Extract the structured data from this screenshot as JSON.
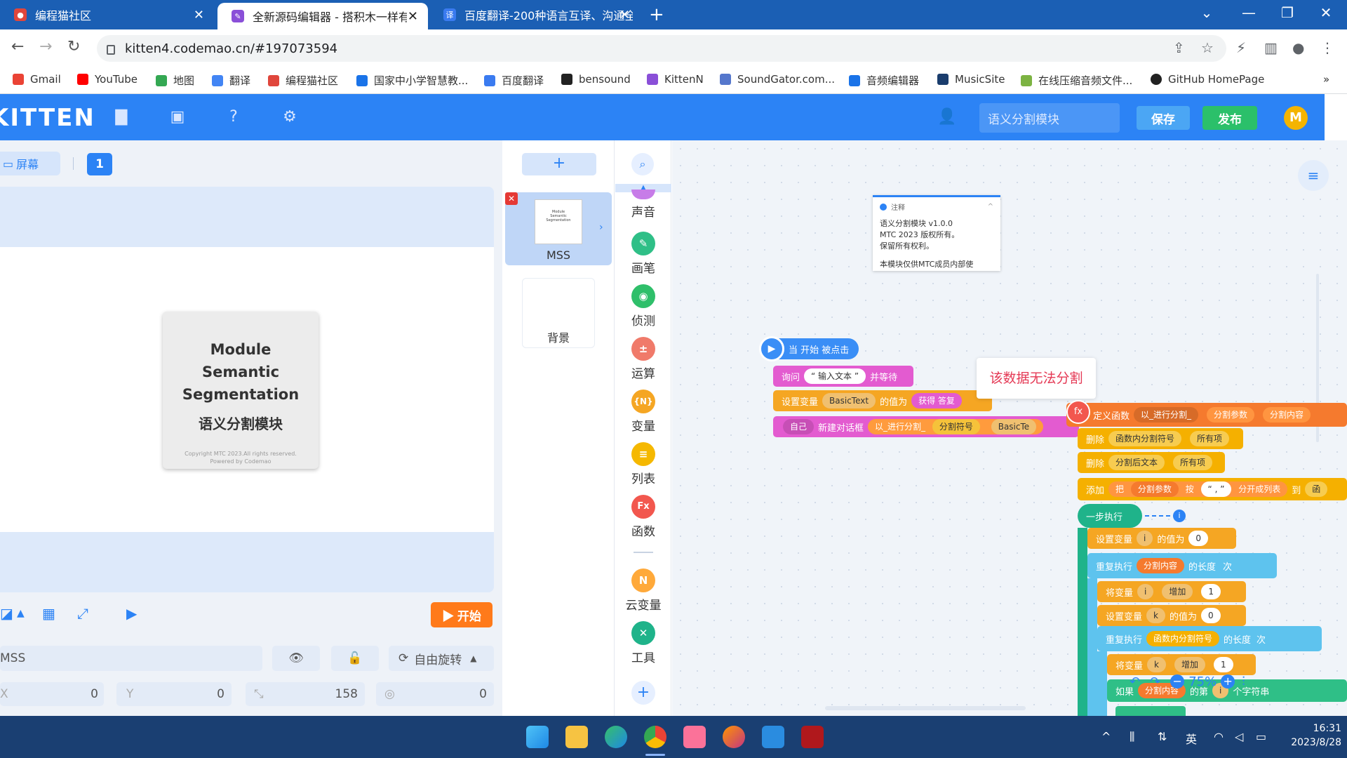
{
  "browser": {
    "tabs": [
      {
        "title": "编程猫社区",
        "active": false
      },
      {
        "title": "全新源码编辑器 - 搭积木一样有趣",
        "active": true
      },
      {
        "title": "百度翻译-200种语言互译、沟通全世界",
        "active": false
      }
    ],
    "url": "kitten4.codemao.cn/#197073594",
    "bookmarks": [
      "Gmail",
      "YouTube",
      "地图",
      "翻译",
      "编程猫社区",
      "国家中小学智慧教...",
      "百度翻译",
      "bensound",
      "KittenN",
      "SoundGator.com...",
      "音频编辑器",
      "MusicSite",
      "在线压缩音频文件...",
      "GitHub HomePage"
    ],
    "bookmarks_more": "»"
  },
  "editor": {
    "logo": "KITTEN",
    "project_name": "语义分割模块",
    "save_label": "保存",
    "publish_label": "发布",
    "avatar_letter": "M",
    "screen_label": "屏幕",
    "page_number": "1",
    "start_label": "开始",
    "cover": {
      "line1": "Module",
      "line2": "Semantic",
      "line3": "Segmentation",
      "subtitle": "语义分割模块",
      "copyright": "Copyright MTC 2023.All rights reserved.",
      "powered": "Powered by Codemao"
    },
    "sprite_field": "MSS",
    "rotation_label": "自由旋转",
    "x_label": "X",
    "x_value": "0",
    "y_label": "Y",
    "y_value": "0",
    "size_value": "158",
    "rotation_value": "0",
    "sprites": [
      {
        "name": "MSS"
      }
    ],
    "background_label": "背景",
    "add_label": "+",
    "categories": [
      {
        "name": "声音",
        "color": "#c77ce8",
        "glyph": "♪"
      },
      {
        "name": "画笔",
        "color": "#2fbf87",
        "glyph": "✎"
      },
      {
        "name": "侦测",
        "color": "#2fbf6a",
        "glyph": "◉"
      },
      {
        "name": "运算",
        "color": "#f07a6a",
        "glyph": "±"
      },
      {
        "name": "变量",
        "color": "#f5a623",
        "glyph": "{N}"
      },
      {
        "name": "列表",
        "color": "#f5b800",
        "glyph": "≡"
      },
      {
        "name": "函数",
        "color": "#f2574e",
        "glyph": "Fx"
      },
      {
        "name": "云变量",
        "color": "#ffa93a",
        "glyph": "N"
      },
      {
        "name": "工具",
        "color": "#1fb38a",
        "glyph": "✕"
      }
    ],
    "comment": {
      "title": "注释",
      "line1": "语义分割模块 v1.0.0",
      "line2": "MTC 2023 版权所有。",
      "line3": "保留所有权利。",
      "line4": "本模块仅供MTC成员内部使"
    },
    "tooltip": "该数据无法分割",
    "zoom": "75%",
    "blocks": {
      "when_start": "当 开始 被点击",
      "ask": "询问",
      "ask_text": "“ 输入文本 ”",
      "ask_wait": "并等待",
      "set_var": "设置变量",
      "var_basic": "BasicText",
      "value_of": "的值为",
      "get_answer": "获得 答复",
      "self": "自己",
      "new_dialog": "新建对话框",
      "split_fn": "以_进行分割_",
      "split_sep": "分割符号",
      "basic_te": "BasicTe",
      "define_fn": "定义函数",
      "fn_name": "以_进行分割_",
      "param1": "分割参数",
      "param2": "分割内容",
      "delete": "删除",
      "list1": "函数内分割符号",
      "all_items": "所有项",
      "list2": "分割后文本",
      "add": "添加",
      "take": "把",
      "by": "按",
      "comma": "“ , ”",
      "split_list": "分开成列表",
      "to": "到",
      "func_short": "函",
      "step_exec": "一步执行",
      "var_i": "i",
      "zero": "0",
      "one": "1",
      "repeat": "重复执行",
      "length_of": "的长度",
      "times": "次",
      "change_var": "将变量",
      "increase": "增加",
      "var_k": "k",
      "if": "如果",
      "nth": "的第",
      "char_of": "个字符串"
    }
  },
  "taskbar": {
    "tray_lang": "英",
    "time": "16:31",
    "date": "2023/8/28"
  }
}
